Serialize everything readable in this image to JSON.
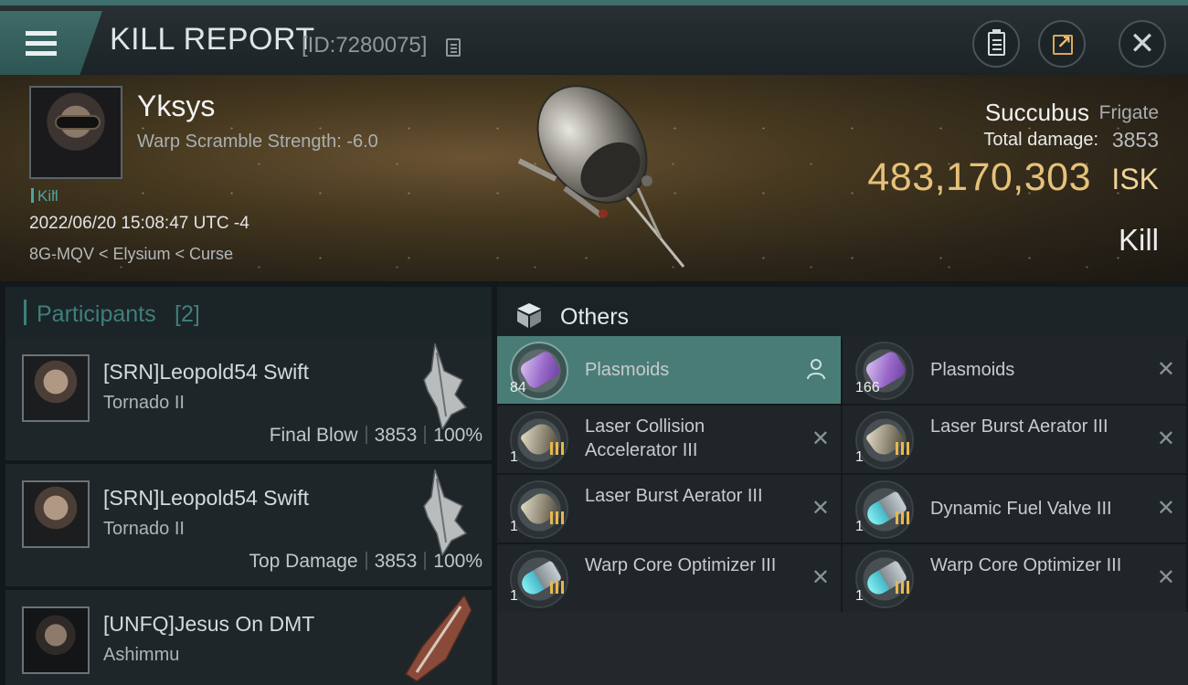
{
  "title": "KILL REPORT",
  "report_id": "[ID:7280075]",
  "victim": {
    "name": "Yksys",
    "warp": "Warp Scramble Strength: -6.0",
    "tag": "Kill",
    "datetime": "2022/06/20 15:08:47 UTC -4",
    "location": "8G-MQV < Elysium < Curse"
  },
  "ship": {
    "name": "Succubus",
    "class": "Frigate",
    "damage_label": "Total damage:",
    "damage": "3853",
    "isk": "483,170,303",
    "isk_unit": "ISK",
    "result": "Kill"
  },
  "participants": {
    "title": "Participants",
    "count": "[2]",
    "items": [
      {
        "name": "[SRN]Leopold54 Swift",
        "ship": "Tornado II",
        "role": "Final Blow",
        "damage": "3853",
        "percent": "100%"
      },
      {
        "name": "[SRN]Leopold54 Swift",
        "ship": "Tornado II",
        "role": "Top Damage",
        "damage": "3853",
        "percent": "100%"
      },
      {
        "name": "[UNFQ]Jesus On DMT",
        "ship": "Ashimmu"
      }
    ]
  },
  "others": {
    "title": "Others",
    "items": [
      {
        "name": "Plasmoids",
        "qty": "84",
        "icon": "plasmoid-icon",
        "selected": true
      },
      {
        "name": "Plasmoids",
        "qty": "166",
        "icon": "plasmoid-icon"
      },
      {
        "name": "Laser Collision Accelerator III",
        "qty": "1",
        "icon": "laser-module-icon"
      },
      {
        "name": "Laser Burst Aerator III",
        "qty": "1",
        "icon": "laser-module-icon"
      },
      {
        "name": "Laser Burst Aerator III",
        "qty": "1",
        "icon": "laser-module-icon"
      },
      {
        "name": "Dynamic Fuel Valve III",
        "qty": "1",
        "icon": "fuel-valve-icon"
      },
      {
        "name": "Warp Core Optimizer III",
        "qty": "1",
        "icon": "warp-core-icon"
      },
      {
        "name": "Warp Core Optimizer III",
        "qty": "1",
        "icon": "warp-core-icon"
      }
    ]
  },
  "colors": {
    "accent": "#4a7c77",
    "isk_gold": "#e6c179",
    "tech_meta": "#e8b74d"
  }
}
